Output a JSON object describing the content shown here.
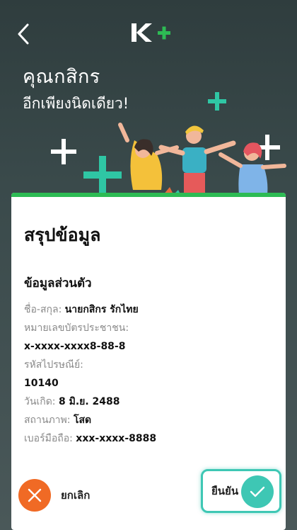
{
  "header": {
    "back_icon": "chevron-left-icon",
    "logo_text": "K+",
    "title": "คุณกสิกร",
    "subtitle": "อีกเพียงนิดเดียว!"
  },
  "summary": {
    "title": "สรุปข้อมูล",
    "section_title": "ข้อมูลส่วนตัว",
    "fields": {
      "name_label": "ชื่อ-สกุล:",
      "name_value": "นายกสิกร รักไทย",
      "id_label": "หมายเลขบัตรประชาชน:",
      "id_value": "x-xxxx-xxxx8-88-8",
      "postal_label": "รหัสไปรษณีย์:",
      "postal_value": "10140",
      "dob_label": "วันเกิด:",
      "dob_value": "8 มิ.ย. 2488",
      "status_label": "สถานภาพ:",
      "status_value": "โสด",
      "phone_label": "เบอร์มือถือ:",
      "phone_value": "xxx-xxxx-8888"
    }
  },
  "actions": {
    "cancel_label": "ยกเลิก",
    "confirm_label": "ยืนยัน"
  },
  "colors": {
    "brand_green": "#2dbb54",
    "accent_teal": "#3ec7b4",
    "cancel_orange": "#f06a25"
  }
}
